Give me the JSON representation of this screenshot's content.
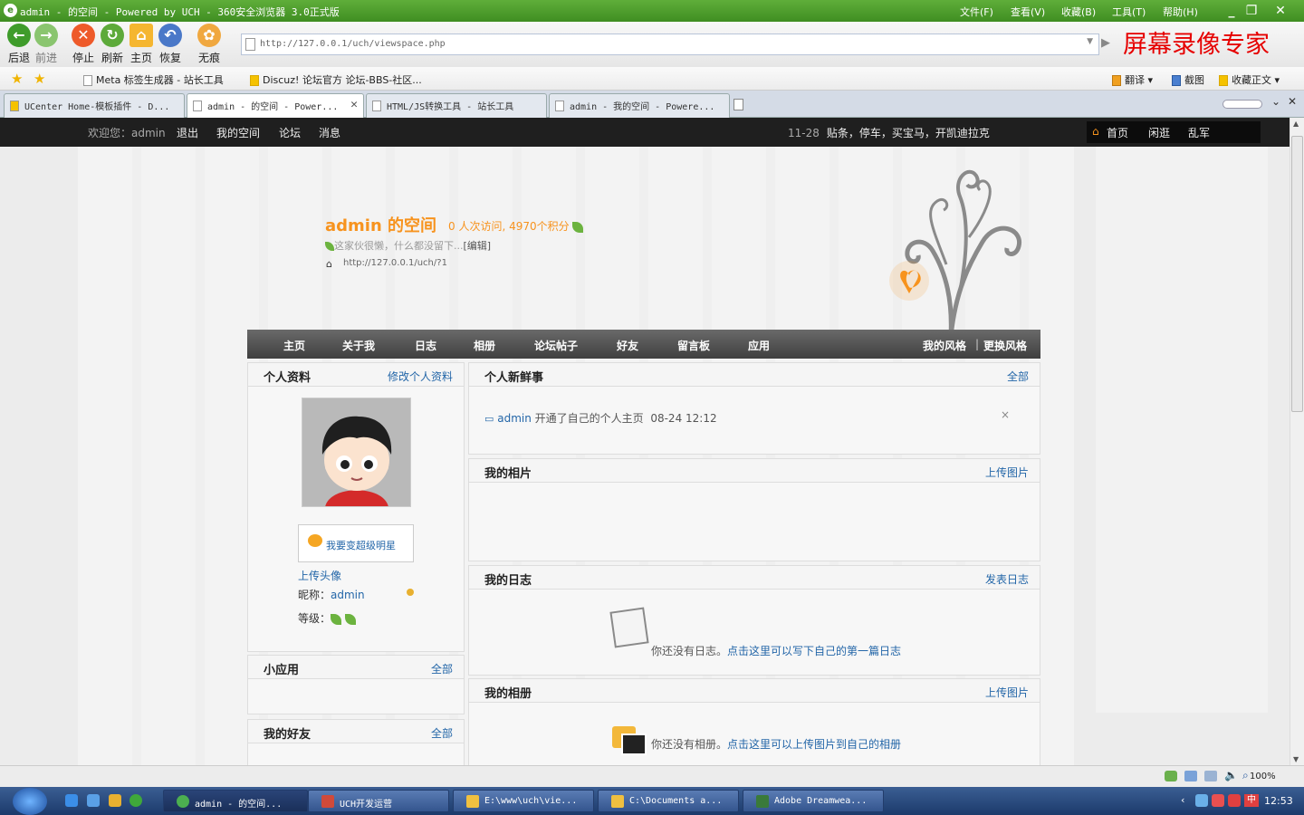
{
  "window": {
    "title": "admin - 的空间 - Powered by UCH - 360安全浏览器 3.0正式版",
    "menu": [
      "文件(F)",
      "查看(V)",
      "收藏(B)",
      "工具(T)",
      "帮助(H)"
    ]
  },
  "toolbar": {
    "buttons": [
      "后退",
      "前进",
      "停止",
      "刷新",
      "主页",
      "恢复",
      "无痕"
    ],
    "address": "http://127.0.0.1/uch/viewspace.php",
    "watermark": "屏幕录像专家"
  },
  "favorites": {
    "items": [
      "Meta 标签生成器 - 站长工具",
      "Discuz! 论坛官方 论坛-BBS-社区..."
    ],
    "right": [
      "翻译",
      "截图",
      "收藏正文"
    ]
  },
  "tabs": [
    {
      "label": "UCenter Home-模板插件 - D..."
    },
    {
      "label": "admin - 的空间 - Power..."
    },
    {
      "label": "HTML/JS转换工具 - 站长工具"
    },
    {
      "label": "admin - 我的空间 - Powere..."
    }
  ],
  "sitebar": {
    "welcome": "欢迎您：",
    "user": "admin",
    "logout": "退出",
    "myspace": "我的空间",
    "forum": "论坛",
    "message": "消息",
    "notice_date": "11-28",
    "notice": "贴条，停车，买宝马，开凯迪拉克",
    "right": [
      "首页",
      "闲逛",
      "乱军"
    ]
  },
  "space": {
    "title": "admin 的空间",
    "stat": "0 人次访问, 4970个积分",
    "motto": "这家伙很懒，什么都没留下...",
    "edit": "[编辑]",
    "url": "http://127.0.0.1/uch/?1"
  },
  "nav": {
    "items": [
      "主页",
      "关于我",
      "日志",
      "相册",
      "论坛帖子",
      "好友",
      "留言板",
      "应用"
    ],
    "my_style": "我的风格",
    "change_style": "更换风格"
  },
  "profile": {
    "title": "个人资料",
    "edit": "修改个人资料",
    "star": "我要变超级明星",
    "upload_avatar": "上传头像",
    "nickname_label": "昵称：",
    "nickname": "admin",
    "level_label": "等级："
  },
  "apps": {
    "title": "小应用",
    "all": "全部"
  },
  "friends": {
    "title": "我的好友",
    "all": "全部"
  },
  "feed": {
    "title": "个人新鲜事",
    "all": "全部",
    "user": "admin",
    "text": "开通了自己的个人主页",
    "time": "08-24 12:12",
    "close": "×"
  },
  "photos": {
    "title": "我的相片",
    "action": "上传图片"
  },
  "blog": {
    "title": "我的日志",
    "action": "发表日志",
    "empty": "你还没有日志。",
    "empty_link": "点击这里可以写下自己的第一篇日志"
  },
  "album": {
    "title": "我的相册",
    "action": "上传图片",
    "empty": "你还没有相册。",
    "empty_link": "点击这里可以上传图片到自己的相册"
  },
  "statusbar": {
    "zoom": "100%"
  },
  "taskbar": {
    "tasks": [
      "admin - 的空间...",
      "UCH开发运营",
      "E:\\www\\uch\\vie...",
      "C:\\Documents a...",
      "Adobe Dreamwea..."
    ],
    "clock": "12:53",
    "ime": "中"
  },
  "colors": {
    "accent": "#f7931e",
    "link": "#2366a8",
    "chrome": "#4a9a2c"
  }
}
